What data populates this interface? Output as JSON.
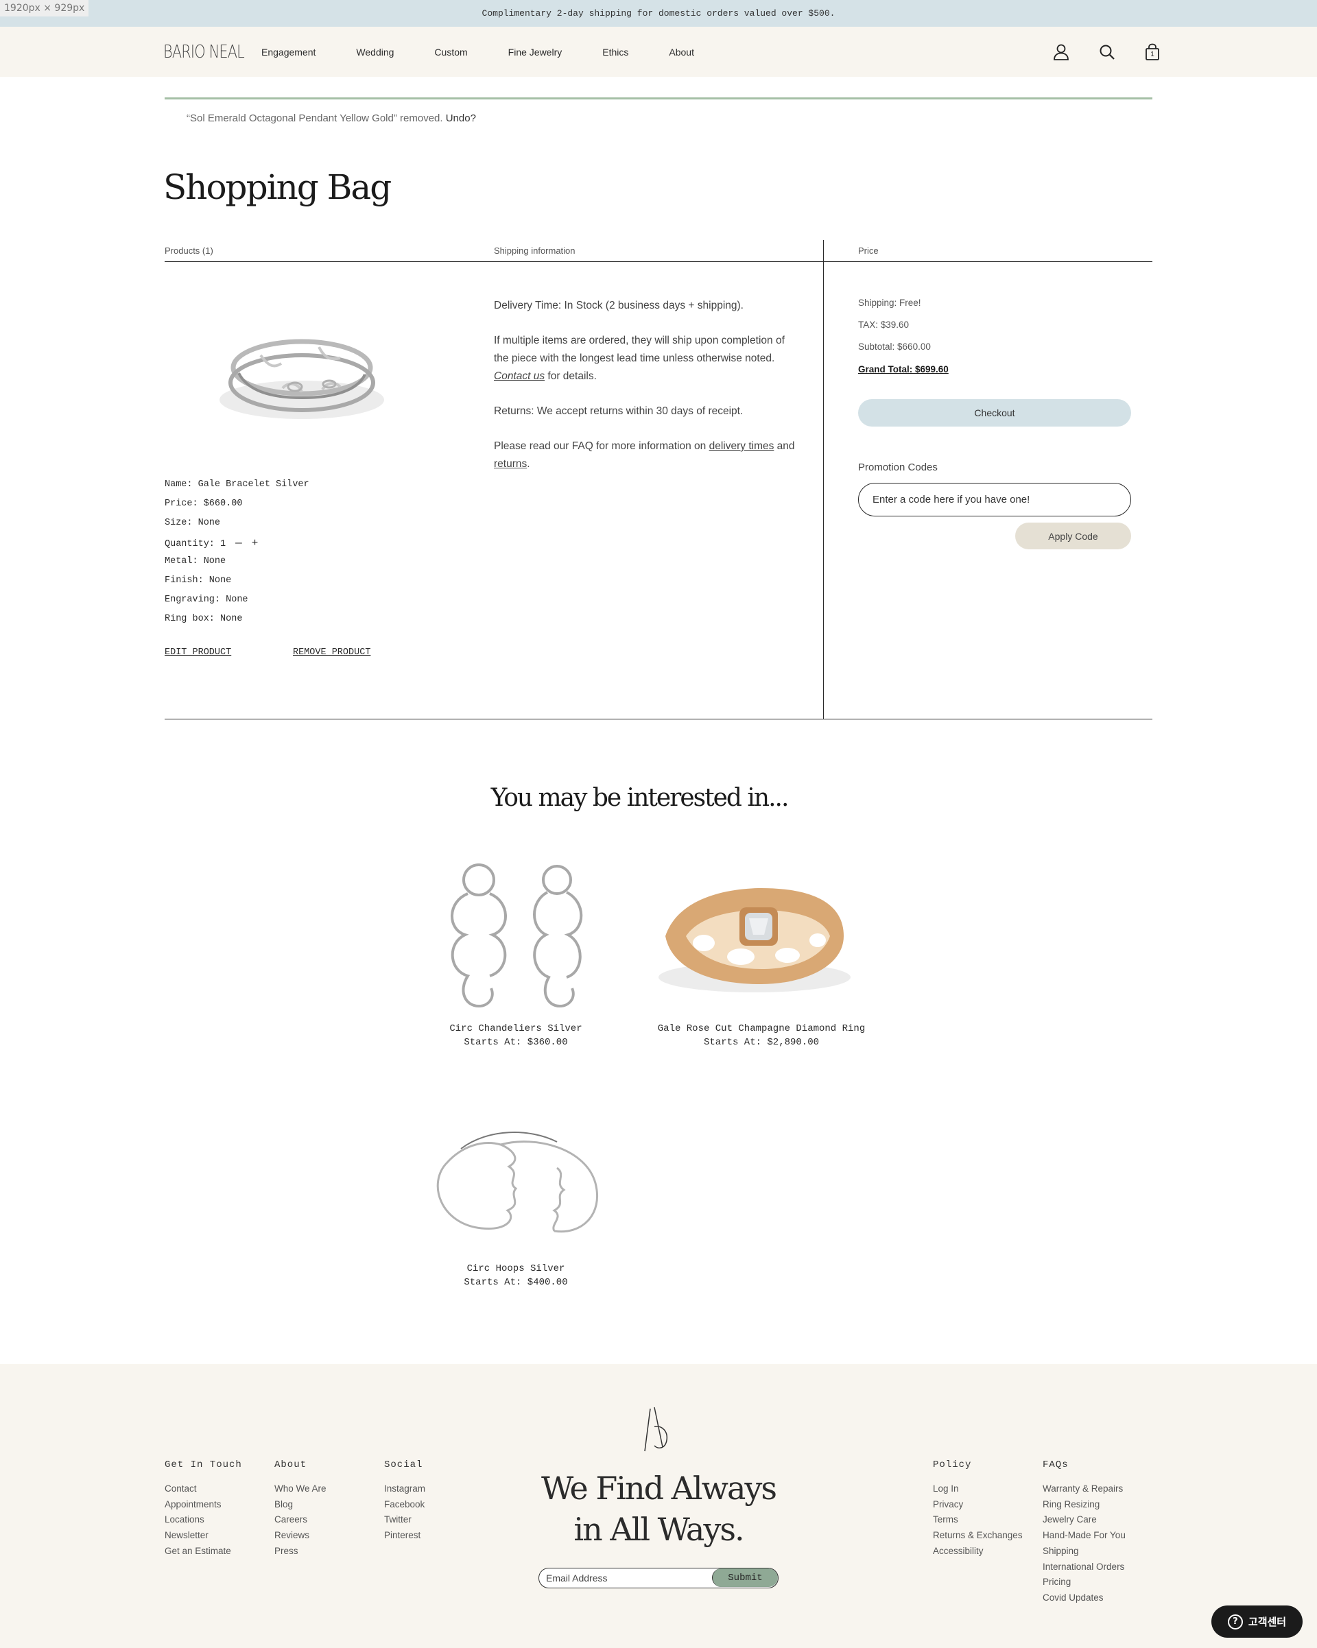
{
  "viewport_label": "1920px × 929px",
  "promo_bar": "Complimentary 2-day shipping for domestic orders valued over $500.",
  "header": {
    "logo": "BARIO NEAL",
    "nav": [
      "Engagement",
      "Wedding",
      "Custom",
      "Fine Jewelry",
      "Ethics",
      "About"
    ],
    "cart_count": "1",
    "icons": [
      "account-icon",
      "search-icon",
      "shopping-bag-icon"
    ]
  },
  "notice": {
    "message": "“Sol Emerald Octagonal Pendant Yellow Gold” removed.",
    "undo": "Undo?"
  },
  "page_title": "Shopping Bag",
  "columns": {
    "products": "Products (1)",
    "shipping": "Shipping information",
    "price": "Price"
  },
  "product": {
    "image_alt": "Gale Bracelet Silver",
    "specs": [
      "Name: Gale Bracelet Silver",
      "Price: $660.00",
      "Size: None",
      "Quantity: 1",
      "Metal: None",
      "Finish: None",
      "Engraving: None",
      "Ring box: None"
    ],
    "qty_minus": "—",
    "qty_plus": "+",
    "edit": "EDIT PRODUCT",
    "remove": "REMOVE PRODUCT"
  },
  "shipping_info": {
    "delivery": "Delivery Time: In Stock (2 business days + shipping).",
    "multiple_pre": "If multiple items are ordered, they will ship upon completion of the piece with the longest lead time unless otherwise noted. ",
    "contact_link": "Contact us",
    "multiple_post": " for details.",
    "returns": "Returns: We accept returns within 30 days of receipt.",
    "faq_pre": "Please read our FAQ for more information on ",
    "delivery_times_link": "delivery times",
    "faq_and": " and ",
    "returns_link": "returns",
    "faq_end": "."
  },
  "price": {
    "shipping": "Shipping: Free!",
    "tax": "TAX: $39.60",
    "subtotal": "Subtotal: $660.00",
    "grand_total": "Grand Total: $699.60",
    "checkout": "Checkout",
    "promo_label": "Promotion Codes",
    "promo_placeholder": "Enter a code here if you have one!",
    "apply": "Apply Code"
  },
  "recommendations": {
    "title": "You may be interested in...",
    "items": [
      {
        "name": "Circ Chandeliers Silver",
        "price": "Starts At: $360.00"
      },
      {
        "name": "Gale Rose Cut Champagne Diamond Ring",
        "price": "Starts At: $2,890.00"
      },
      {
        "name": "Circ Hoops Silver",
        "price": "Starts At: $400.00"
      }
    ]
  },
  "footer": {
    "columns": [
      {
        "title": "Get In Touch",
        "links": [
          "Contact",
          "Appointments",
          "Locations",
          "Newsletter",
          "Get an Estimate"
        ]
      },
      {
        "title": "About",
        "links": [
          "Who We Are",
          "Blog",
          "Careers",
          "Reviews",
          "Press"
        ]
      },
      {
        "title": "Social",
        "links": [
          "Instagram",
          "Facebook",
          "Twitter",
          "Pinterest"
        ]
      },
      {
        "title": "Policy",
        "links": [
          "Log In",
          "Privacy",
          "Terms",
          "Returns & Exchanges",
          "Accessibility"
        ]
      },
      {
        "title": "FAQs",
        "links": [
          "Warranty & Repairs",
          "Ring Resizing",
          "Jewelry Care",
          "Hand-Made For You",
          "Shipping",
          "International Orders",
          "Pricing",
          "Covid Updates"
        ]
      }
    ],
    "tagline_line1": "We Find Always",
    "tagline_line2": "in All Ways.",
    "email_placeholder": "Email Address",
    "submit": "Submit"
  },
  "help_button": "고객센터",
  "colors": {
    "promo_bar": "#d5e2e7",
    "header_bg": "#f8f5ef",
    "notice_line": "#a5bfa6",
    "checkout_btn": "#d3e1e6",
    "apply_btn": "#e5e0d4",
    "submit_btn": "#8fa995",
    "help_btn": "#1b1b1b"
  }
}
